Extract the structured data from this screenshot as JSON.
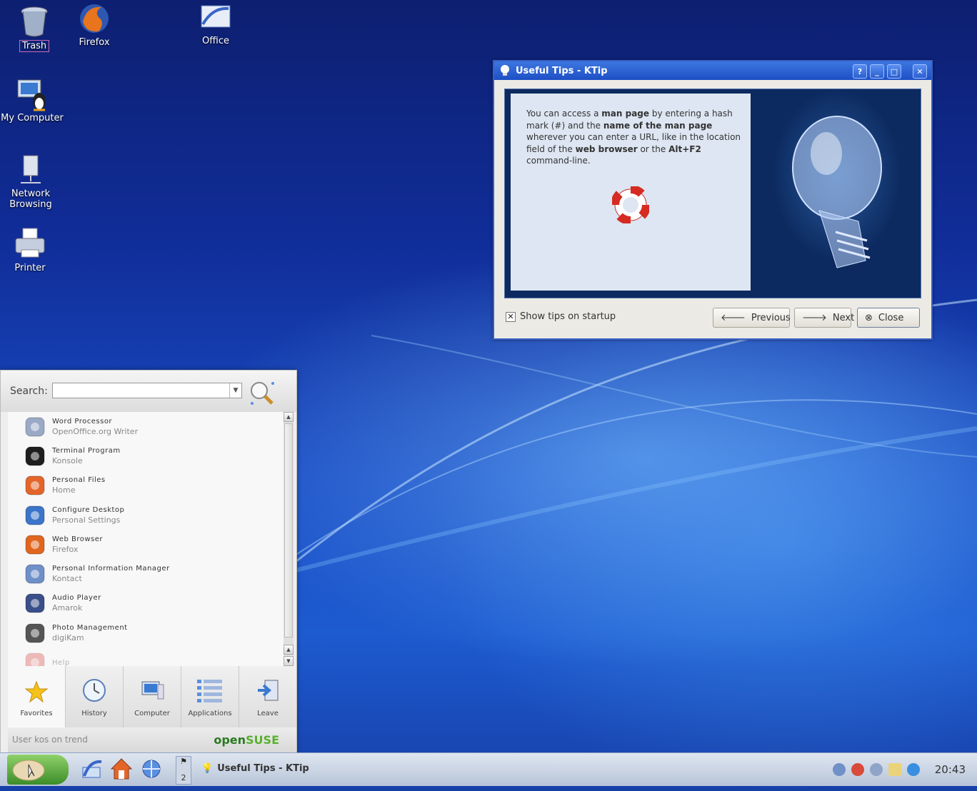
{
  "desktop": {
    "icons": [
      {
        "name": "trash-icon",
        "label": "Trash"
      },
      {
        "name": "firefox-icon",
        "label": "Firefox"
      },
      {
        "name": "office-icon",
        "label": "Office"
      },
      {
        "name": "my-computer-icon",
        "label": "My Computer"
      },
      {
        "name": "network-browsing-icon",
        "label": "Network Browsing"
      },
      {
        "name": "printer-icon",
        "label": "Printer"
      }
    ]
  },
  "ktip": {
    "title": "Useful Tips - KTip",
    "tip_parts": [
      {
        "text": "You can access a ",
        "bold": false
      },
      {
        "text": "man page",
        "bold": true
      },
      {
        "text": " by entering a hash mark (#) and the ",
        "bold": false
      },
      {
        "text": "name of the man page",
        "bold": true
      },
      {
        "text": " wherever you can enter a URL, like in the location field of the ",
        "bold": false
      },
      {
        "text": "web browser",
        "bold": true
      },
      {
        "text": " or the ",
        "bold": false
      },
      {
        "text": "Alt+F2",
        "bold": true
      },
      {
        "text": " command-line.",
        "bold": false
      }
    ],
    "show_tips_label": "Show tips on startup",
    "show_tips_checked": true,
    "previous_label": "Previous",
    "next_label": "Next",
    "close_label": "Close",
    "title_buttons": [
      "?",
      "_",
      "□",
      "✕"
    ]
  },
  "kickoff": {
    "search_label": "Search:",
    "search_value": "",
    "items": [
      {
        "title": "Word Processor",
        "subtitle": "OpenOffice.org Writer",
        "icon": "word-processor-icon",
        "color": "#9aa9c6"
      },
      {
        "title": "Terminal Program",
        "subtitle": "Konsole",
        "icon": "terminal-icon",
        "color": "#1e1e1e"
      },
      {
        "title": "Personal Files",
        "subtitle": "Home",
        "icon": "home-icon",
        "color": "#e4652a"
      },
      {
        "title": "Configure Desktop",
        "subtitle": "Personal Settings",
        "icon": "configure-desktop-icon",
        "color": "#3b74c9"
      },
      {
        "title": "Web Browser",
        "subtitle": "Firefox",
        "icon": "firefox-icon",
        "color": "#e0661f"
      },
      {
        "title": "Personal Information Manager",
        "subtitle": "Kontact",
        "icon": "kontact-icon",
        "color": "#6f8fc9"
      },
      {
        "title": "Audio Player",
        "subtitle": "Amarok",
        "icon": "amarok-icon",
        "color": "#3a4f8a"
      },
      {
        "title": "Photo Management",
        "subtitle": "digiKam",
        "icon": "digikam-icon",
        "color": "#555555"
      },
      {
        "title": "Help",
        "subtitle": "",
        "icon": "help-icon",
        "color": "#d9463d",
        "faded": true
      }
    ],
    "tabs": [
      {
        "label": "Favorites",
        "icon": "star-icon"
      },
      {
        "label": "History",
        "icon": "clock-icon"
      },
      {
        "label": "Computer",
        "icon": "computer-icon"
      },
      {
        "label": "Applications",
        "icon": "applications-icon"
      },
      {
        "label": "Leave",
        "icon": "leave-icon"
      }
    ],
    "user_line": "User kos on trend",
    "brand_open": "open",
    "brand_suse": "SUSE"
  },
  "taskbar": {
    "pager_number": "2",
    "task_title": "Useful Tips - KTip",
    "clock": "20:43"
  },
  "colors": {
    "accent": "#1d4fc6",
    "brand_green": "#5ab031"
  }
}
